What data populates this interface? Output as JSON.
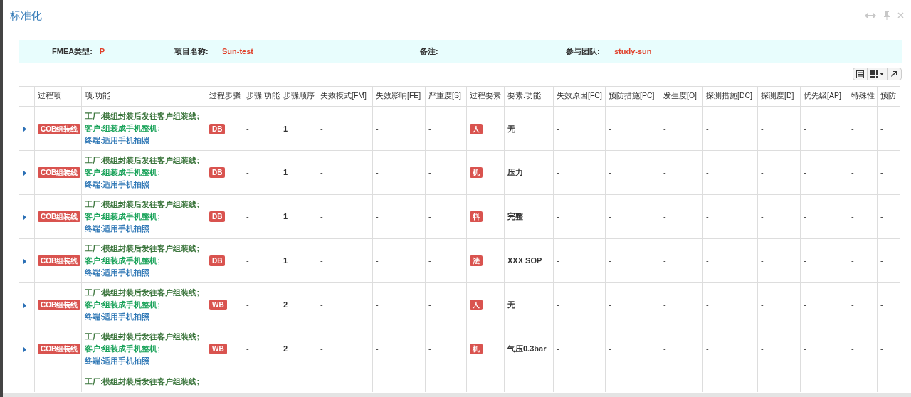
{
  "dialog": {
    "title": "标准化"
  },
  "info_bar": [
    {
      "label": "FMEA类型:",
      "value": "P"
    },
    {
      "label": "项目名称:",
      "value": "Sun-test"
    },
    {
      "label": "备注:"
    },
    {
      "label": "参与团队:",
      "value": "study-sun"
    }
  ],
  "table": {
    "columns": [
      {
        "kind": "expander"
      },
      {
        "label": "过程项",
        "kind": "badge"
      },
      {
        "label": "项.功能",
        "kind": "functions"
      },
      {
        "label": "过程步骤",
        "kind": "badge"
      },
      {
        "label": "步骤.功能",
        "kind": "text"
      },
      {
        "label": "步骤顺序",
        "kind": "bold"
      },
      {
        "label": "失效模式[FM]",
        "kind": "text"
      },
      {
        "label": "失效影响[FE]",
        "kind": "text"
      },
      {
        "label": "严重度[S]",
        "kind": "text"
      },
      {
        "label": "过程要素",
        "kind": "badge"
      },
      {
        "label": "要素.功能",
        "kind": "bold"
      },
      {
        "label": "失效原因[FC]",
        "kind": "text"
      },
      {
        "label": "预防措施[PC]",
        "kind": "text"
      },
      {
        "label": "发生度[O]",
        "kind": "text"
      },
      {
        "label": "探测措施[DC]",
        "kind": "text"
      },
      {
        "label": "探测度[D]",
        "kind": "text"
      },
      {
        "label": "优先级[AP]",
        "kind": "text"
      },
      {
        "label": "特殊性",
        "kind": "text"
      },
      {
        "label": "预防",
        "kind": "text"
      }
    ],
    "rows": [
      {
        "expanded": false,
        "cells": [
          null,
          "COB组装线",
          [
            {
              "kind": "factory",
              "text": "工厂:模组封装后发往客户组装线;"
            },
            {
              "kind": "customer",
              "text": "客户:组装成手机整机;"
            },
            {
              "kind": "end_user",
              "text": "终端:适用手机拍照"
            }
          ],
          "DB",
          "-",
          "1",
          "-",
          "-",
          "-",
          "人",
          "无",
          "-",
          "-",
          "-",
          "-",
          "-",
          "-",
          "-",
          "-"
        ]
      },
      {
        "expanded": false,
        "cells": [
          null,
          "COB组装线",
          [
            {
              "kind": "factory",
              "text": "工厂:模组封装后发往客户组装线;"
            },
            {
              "kind": "customer",
              "text": "客户:组装成手机整机;"
            },
            {
              "kind": "end_user",
              "text": "终端:适用手机拍照"
            }
          ],
          "DB",
          "-",
          "1",
          "-",
          "-",
          "-",
          "机",
          "压力",
          "-",
          "-",
          "-",
          "-",
          "-",
          "-",
          "-",
          "-"
        ]
      },
      {
        "expanded": false,
        "cells": [
          null,
          "COB组装线",
          [
            {
              "kind": "factory",
              "text": "工厂:模组封装后发往客户组装线;"
            },
            {
              "kind": "customer",
              "text": "客户:组装成手机整机;"
            },
            {
              "kind": "end_user",
              "text": "终端:适用手机拍照"
            }
          ],
          "DB",
          "-",
          "1",
          "-",
          "-",
          "-",
          "料",
          "完整",
          "-",
          "-",
          "-",
          "-",
          "-",
          "-",
          "-",
          "-"
        ]
      },
      {
        "expanded": false,
        "cells": [
          null,
          "COB组装线",
          [
            {
              "kind": "factory",
              "text": "工厂:模组封装后发往客户组装线;"
            },
            {
              "kind": "customer",
              "text": "客户:组装成手机整机;"
            },
            {
              "kind": "end_user",
              "text": "终端:适用手机拍照"
            }
          ],
          "DB",
          "-",
          "1",
          "-",
          "-",
          "-",
          "法",
          "XXX SOP",
          "-",
          "-",
          "-",
          "-",
          "-",
          "-",
          "-",
          "-"
        ]
      },
      {
        "expanded": false,
        "cells": [
          null,
          "COB组装线",
          [
            {
              "kind": "factory",
              "text": "工厂:模组封装后发往客户组装线;"
            },
            {
              "kind": "customer",
              "text": "客户:组装成手机整机;"
            },
            {
              "kind": "end_user",
              "text": "终端:适用手机拍照"
            }
          ],
          "WB",
          "-",
          "2",
          "-",
          "-",
          "-",
          "人",
          "无",
          "-",
          "-",
          "-",
          "-",
          "-",
          "-",
          "-",
          "-"
        ]
      },
      {
        "expanded": false,
        "cells": [
          null,
          "COB组装线",
          [
            {
              "kind": "factory",
              "text": "工厂:模组封装后发往客户组装线;"
            },
            {
              "kind": "customer",
              "text": "客户:组装成手机整机;"
            },
            {
              "kind": "end_user",
              "text": "终端:适用手机拍照"
            }
          ],
          "WB",
          "-",
          "2",
          "-",
          "-",
          "-",
          "机",
          "气压0.3bar",
          "-",
          "-",
          "-",
          "-",
          "-",
          "-",
          "-",
          "-"
        ]
      },
      {
        "cells": [
          null,
          null,
          [
            {
              "kind": "factory",
              "text": "工厂:模组封装后发往客户组装线;"
            }
          ],
          null,
          null,
          null,
          null,
          null,
          null,
          null,
          null,
          null,
          null,
          null,
          null,
          null,
          null,
          null,
          null
        ]
      }
    ]
  }
}
